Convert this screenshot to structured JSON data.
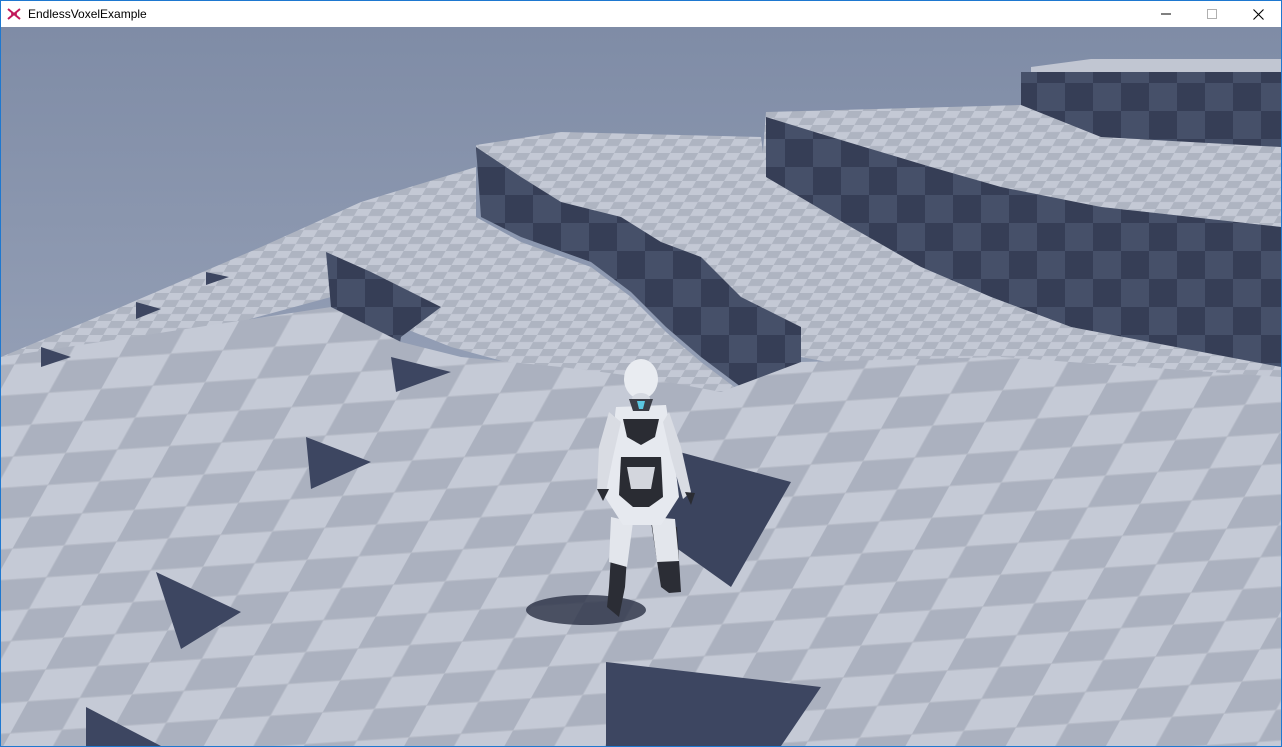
{
  "window": {
    "title": "EndlessVoxelExample",
    "app_icon": "unity-game-icon",
    "controls": {
      "minimize_icon": "minimize-icon",
      "maximize_icon": "maximize-icon",
      "close_icon": "close-icon"
    }
  },
  "scene": {
    "description_icon": "voxel-terrain",
    "colors": {
      "sky_top": "#7d8aa4",
      "sky_bottom": "#b9c1d1",
      "ground_light": "#c3c8d4",
      "ground_dark": "#a7adbb",
      "cliff_light": "#4a5470",
      "cliff_dark": "#353d55",
      "character": "#e8eaee",
      "character_dark": "#2a2c33"
    }
  }
}
